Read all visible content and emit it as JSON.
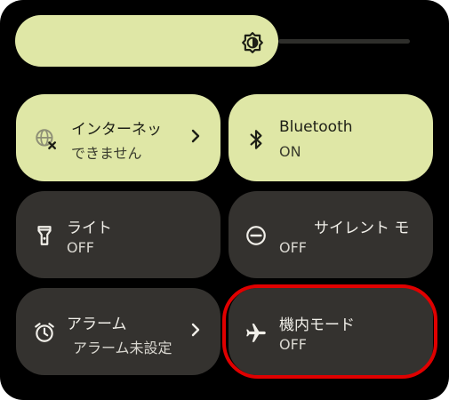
{
  "quick_settings": {
    "tiles": [
      {
        "title": "インターネッ",
        "subtitle": "できません",
        "icon": "internet-no-connection-icon",
        "state": "on",
        "has_chevron": true
      },
      {
        "title": "Bluetooth",
        "subtitle": "ON",
        "icon": "bluetooth-icon",
        "state": "on",
        "has_chevron": false
      },
      {
        "title": "ライト",
        "subtitle": "OFF",
        "icon": "flashlight-icon",
        "state": "off",
        "has_chevron": false
      },
      {
        "title": "サイレント モ",
        "subtitle": "OFF",
        "icon": "do-not-disturb-icon",
        "state": "off",
        "has_chevron": false
      },
      {
        "title": "アラーム",
        "subtitle": "アラーム未設定",
        "icon": "alarm-clock-icon",
        "state": "off",
        "has_chevron": true
      },
      {
        "title": "機内モード",
        "subtitle": "OFF",
        "icon": "airplane-icon",
        "state": "off",
        "has_chevron": false
      }
    ],
    "colors": {
      "tile_on": "#dfe7a6",
      "tile_off": "#34322f",
      "highlight": "#e00000"
    }
  }
}
